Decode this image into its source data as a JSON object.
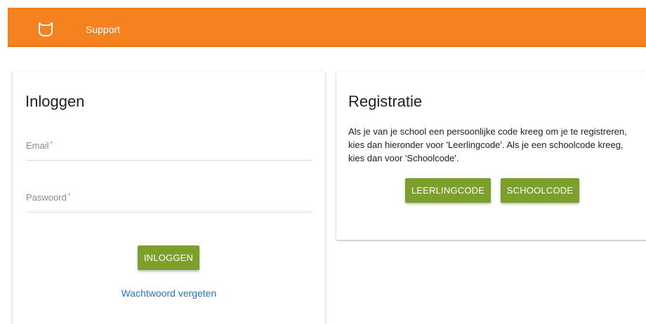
{
  "topbar": {
    "logo_icon": "owl-icon",
    "support_label": "Support",
    "color": "#f5821f"
  },
  "login": {
    "title": "Inloggen",
    "email_label": "Email",
    "email_value": "",
    "password_label": "Paswoord",
    "password_value": "",
    "required_mark": "*",
    "submit_label": "INLOGGEN",
    "forgot_label": "Wachtwoord vergeten"
  },
  "registration": {
    "title": "Registratie",
    "description": "Als je van je school een persoonlijke code kreeg om je te registreren, kies dan hieronder voor 'Leerlingcode'. Als je een schoolcode kreeg, kies dan voor 'Schoolcode'.",
    "student_code_label": "LEERLINGCODE",
    "school_code_label": "SCHOOLCODE"
  },
  "colors": {
    "accent": "#f5821f",
    "button": "#7d9f2c",
    "link": "#2f74b5"
  }
}
